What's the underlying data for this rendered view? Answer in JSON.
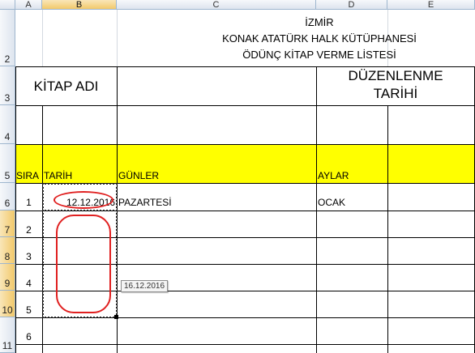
{
  "columns": [
    "A",
    "B",
    "C",
    "D",
    "E"
  ],
  "rows": [
    "2",
    "3",
    "4",
    "5",
    "6",
    "7",
    "8",
    "9",
    "10",
    "11"
  ],
  "title": {
    "line1": "İZMİR",
    "line2": "KONAK ATATÜRK HALK KÜTÜPHANESİ",
    "line3": "ÖDÜNÇ KİTAP VERME LİSTESİ"
  },
  "row3": {
    "kitap_adi": "KİTAP ADI",
    "duzenlenme_1": "DÜZENLENME",
    "duzenlenme_2": "TARİHİ"
  },
  "headers": {
    "sira": "SIRA",
    "tarih": "TARİH",
    "gunler": "GÜNLER",
    "aylar": "AYLAR"
  },
  "row6": {
    "sira": "1",
    "tarih": "12.12.2016",
    "gun": "PAZARTESİ",
    "ay": "OCAK"
  },
  "sira_numbers": [
    "2",
    "3",
    "4",
    "5",
    "6"
  ],
  "tooltip": "16.12.2016",
  "colors": {
    "header_fill": "#ffff00",
    "annotation": "#e02020",
    "grid": "#d4d9e0"
  }
}
